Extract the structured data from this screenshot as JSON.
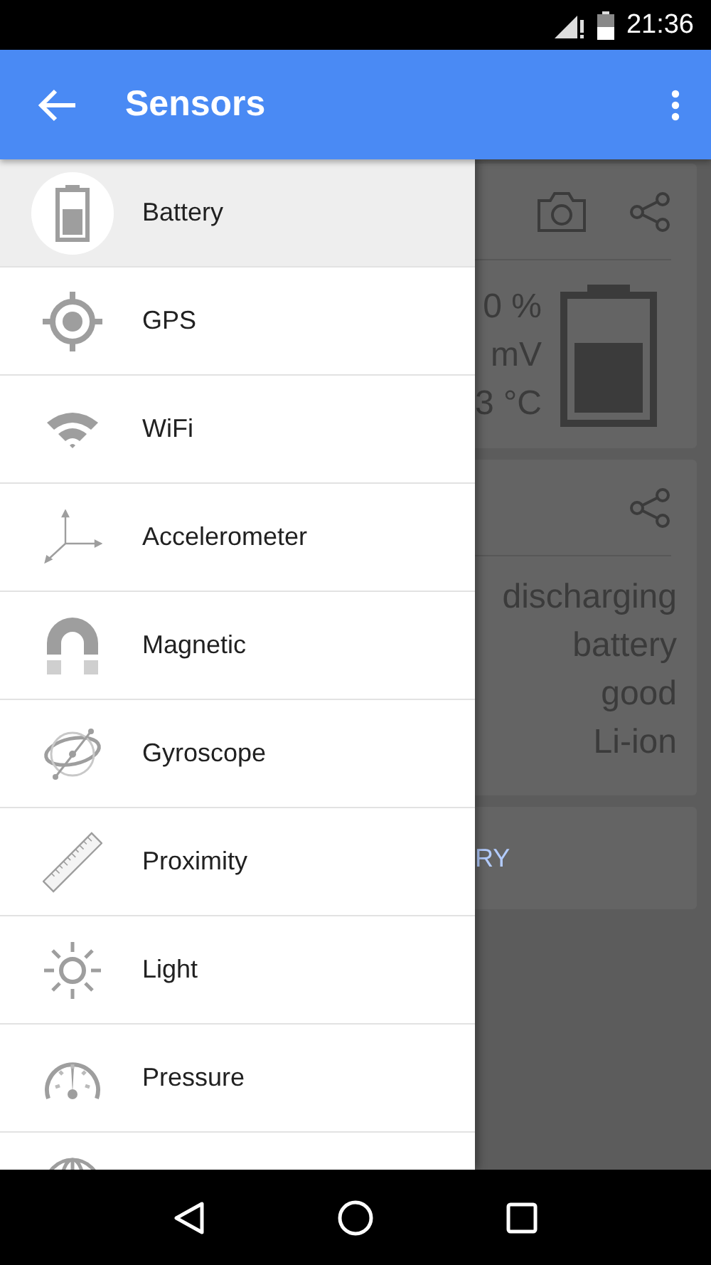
{
  "status_bar": {
    "time": "21:36"
  },
  "app_bar": {
    "title": "Sensors"
  },
  "drawer": {
    "items": [
      {
        "label": "Battery",
        "selected": true
      },
      {
        "label": "GPS",
        "selected": false
      },
      {
        "label": "WiFi",
        "selected": false
      },
      {
        "label": "Accelerometer",
        "selected": false
      },
      {
        "label": "Magnetic",
        "selected": false
      },
      {
        "label": "Gyroscope",
        "selected": false
      },
      {
        "label": "Proximity",
        "selected": false
      },
      {
        "label": "Light",
        "selected": false
      },
      {
        "label": "Pressure",
        "selected": false
      }
    ]
  },
  "background": {
    "readings": [
      "0 %",
      "mV",
      "3 °C"
    ],
    "details": [
      "discharging",
      "battery",
      "good",
      "Li-ion"
    ],
    "link": "RY"
  }
}
